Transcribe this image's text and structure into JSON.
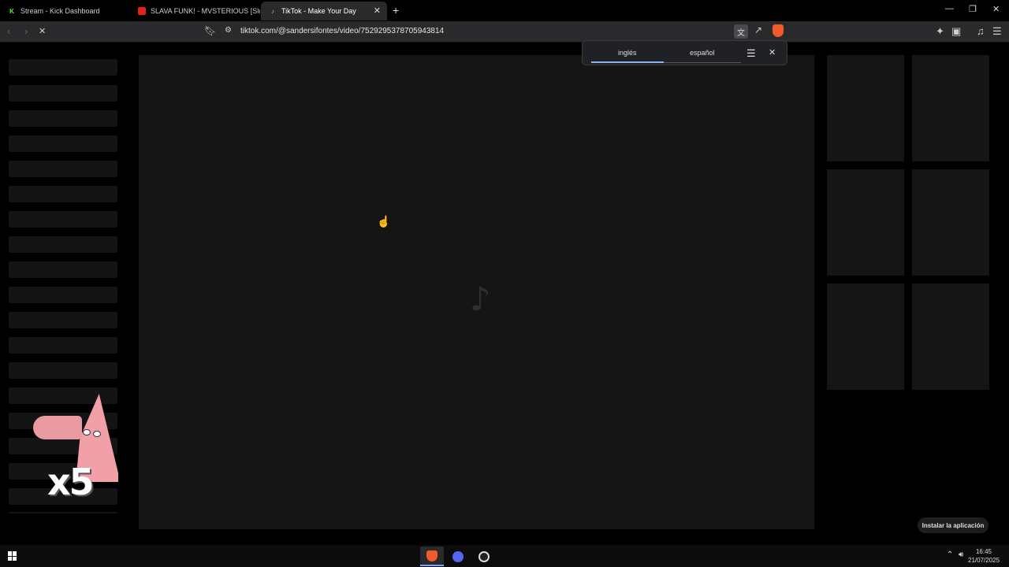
{
  "browser": {
    "tabs": [
      {
        "title": "Stream - Kick Dashboard",
        "favicon": "kick-icon",
        "active": false
      },
      {
        "title": "SLAVA FUNK! - MVSTERIOUS [Slowe",
        "favicon": "youtube-icon",
        "active": false
      },
      {
        "title": "TikTok - Make Your Day",
        "favicon": "tiktok-icon",
        "active": true
      }
    ],
    "url": "tiktok.com/@sandersifontes/video/7529295378705943814"
  },
  "translate_popup": {
    "source_lang": "inglés",
    "target_lang": "español"
  },
  "page": {
    "install_button": "Instalar la aplicación",
    "logo": "♪"
  },
  "overlay": {
    "multiplier": "x5"
  },
  "taskbar": {
    "time": "16:45",
    "date": "21/07/2025"
  },
  "colors": {
    "accent": "#8ab4f8",
    "kick": "#53fc18",
    "youtube": "#e62117",
    "brave": "#f15a2b"
  }
}
